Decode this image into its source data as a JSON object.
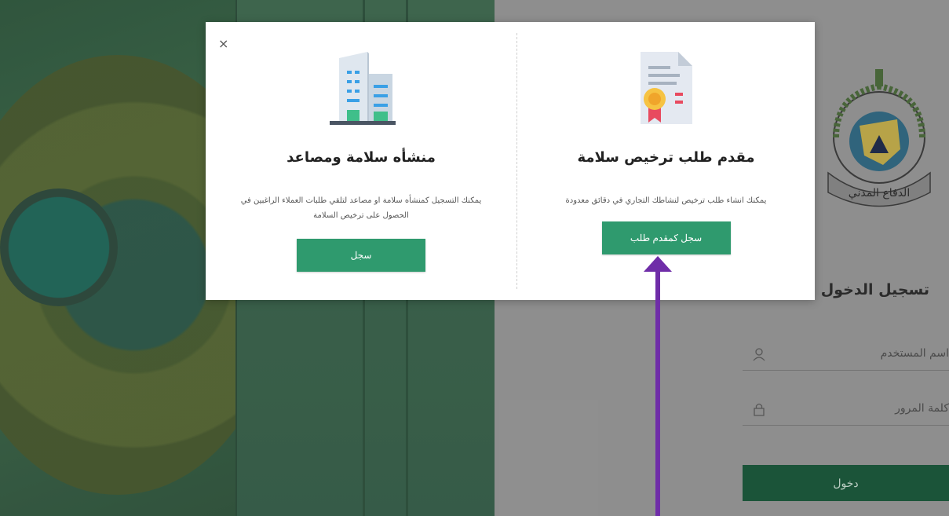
{
  "modal": {
    "close_label": "×",
    "left_card": {
      "title": "منشأه سلامة ومصاعد",
      "description": "يمكنك التسجيل كمنشأه سلامة او مصاعد لتلقي طلبات العملاء الراغبين في الحصول على ترخيص السلامة",
      "button_label": "سجل",
      "icon": "building-icon"
    },
    "right_card": {
      "title": "مقدم طلب ترخيص سلامة",
      "description": "يمكنك انشاء طلب ترخيص لنشاطك التجاري في دقائق معدودة",
      "button_label": "سجل كمقدم طلب",
      "icon": "certificate-icon"
    }
  },
  "login": {
    "title": "تسجيل الدخول",
    "username_placeholder": "اسم المستخدم",
    "password_placeholder": "كلمة المرور",
    "submit_label": "دخول",
    "emblem_text": "الدفاع المدني"
  },
  "colors": {
    "primary_green": "#2f9a6e",
    "login_green": "#17583a",
    "arrow_purple": "#6f2da8"
  }
}
